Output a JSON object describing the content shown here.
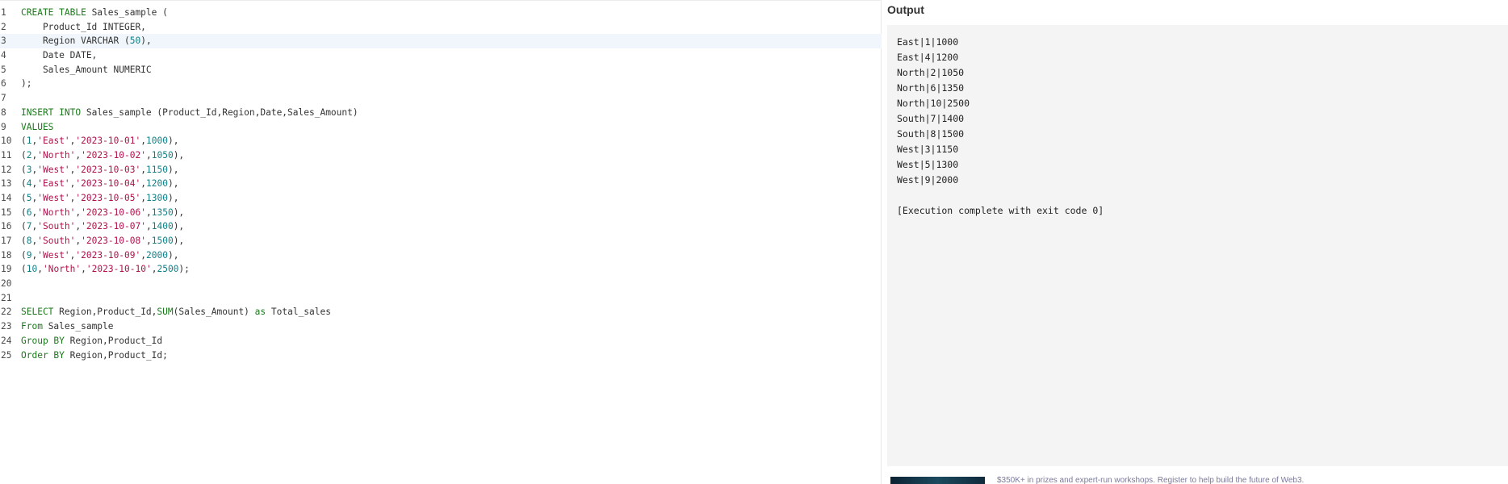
{
  "editor": {
    "active_line": 3,
    "lines": [
      {
        "n": "1",
        "tokens": [
          {
            "t": "CREATE TABLE ",
            "c": "kw"
          },
          {
            "t": "Sales_sample (",
            "c": "plain"
          }
        ]
      },
      {
        "n": "2",
        "tokens": [
          {
            "t": "    Product_Id INTEGER,",
            "c": "plain"
          }
        ]
      },
      {
        "n": "3",
        "tokens": [
          {
            "t": "    Region VARCHAR (",
            "c": "plain"
          },
          {
            "t": "50",
            "c": "num"
          },
          {
            "t": "),",
            "c": "plain"
          }
        ]
      },
      {
        "n": "4",
        "tokens": [
          {
            "t": "    Date DATE,",
            "c": "plain"
          }
        ]
      },
      {
        "n": "5",
        "tokens": [
          {
            "t": "    Sales_Amount NUMERIC",
            "c": "plain"
          }
        ]
      },
      {
        "n": "6",
        "tokens": [
          {
            "t": ");",
            "c": "plain"
          }
        ]
      },
      {
        "n": "7",
        "tokens": []
      },
      {
        "n": "8",
        "tokens": [
          {
            "t": "INSERT INTO ",
            "c": "kw"
          },
          {
            "t": "Sales_sample (Product_Id,Region,Date,Sales_Amount)",
            "c": "plain"
          }
        ]
      },
      {
        "n": "9",
        "tokens": [
          {
            "t": "VALUES",
            "c": "kw"
          }
        ]
      },
      {
        "n": "10",
        "tokens": [
          {
            "t": "(",
            "c": "plain"
          },
          {
            "t": "1",
            "c": "num"
          },
          {
            "t": ",",
            "c": "plain"
          },
          {
            "t": "'East'",
            "c": "str"
          },
          {
            "t": ",",
            "c": "plain"
          },
          {
            "t": "'2023-10-01'",
            "c": "str"
          },
          {
            "t": ",",
            "c": "plain"
          },
          {
            "t": "1000",
            "c": "num"
          },
          {
            "t": "),",
            "c": "plain"
          }
        ]
      },
      {
        "n": "11",
        "tokens": [
          {
            "t": "(",
            "c": "plain"
          },
          {
            "t": "2",
            "c": "num"
          },
          {
            "t": ",",
            "c": "plain"
          },
          {
            "t": "'North'",
            "c": "str"
          },
          {
            "t": ",",
            "c": "plain"
          },
          {
            "t": "'2023-10-02'",
            "c": "str"
          },
          {
            "t": ",",
            "c": "plain"
          },
          {
            "t": "1050",
            "c": "num"
          },
          {
            "t": "),",
            "c": "plain"
          }
        ]
      },
      {
        "n": "12",
        "tokens": [
          {
            "t": "(",
            "c": "plain"
          },
          {
            "t": "3",
            "c": "num"
          },
          {
            "t": ",",
            "c": "plain"
          },
          {
            "t": "'West'",
            "c": "str"
          },
          {
            "t": ",",
            "c": "plain"
          },
          {
            "t": "'2023-10-03'",
            "c": "str"
          },
          {
            "t": ",",
            "c": "plain"
          },
          {
            "t": "1150",
            "c": "num"
          },
          {
            "t": "),",
            "c": "plain"
          }
        ]
      },
      {
        "n": "13",
        "tokens": [
          {
            "t": "(",
            "c": "plain"
          },
          {
            "t": "4",
            "c": "num"
          },
          {
            "t": ",",
            "c": "plain"
          },
          {
            "t": "'East'",
            "c": "str"
          },
          {
            "t": ",",
            "c": "plain"
          },
          {
            "t": "'2023-10-04'",
            "c": "str"
          },
          {
            "t": ",",
            "c": "plain"
          },
          {
            "t": "1200",
            "c": "num"
          },
          {
            "t": "),",
            "c": "plain"
          }
        ]
      },
      {
        "n": "14",
        "tokens": [
          {
            "t": "(",
            "c": "plain"
          },
          {
            "t": "5",
            "c": "num"
          },
          {
            "t": ",",
            "c": "plain"
          },
          {
            "t": "'West'",
            "c": "str"
          },
          {
            "t": ",",
            "c": "plain"
          },
          {
            "t": "'2023-10-05'",
            "c": "str"
          },
          {
            "t": ",",
            "c": "plain"
          },
          {
            "t": "1300",
            "c": "num"
          },
          {
            "t": "),",
            "c": "plain"
          }
        ]
      },
      {
        "n": "15",
        "tokens": [
          {
            "t": "(",
            "c": "plain"
          },
          {
            "t": "6",
            "c": "num"
          },
          {
            "t": ",",
            "c": "plain"
          },
          {
            "t": "'North'",
            "c": "str"
          },
          {
            "t": ",",
            "c": "plain"
          },
          {
            "t": "'2023-10-06'",
            "c": "str"
          },
          {
            "t": ",",
            "c": "plain"
          },
          {
            "t": "1350",
            "c": "num"
          },
          {
            "t": "),",
            "c": "plain"
          }
        ]
      },
      {
        "n": "16",
        "tokens": [
          {
            "t": "(",
            "c": "plain"
          },
          {
            "t": "7",
            "c": "num"
          },
          {
            "t": ",",
            "c": "plain"
          },
          {
            "t": "'South'",
            "c": "str"
          },
          {
            "t": ",",
            "c": "plain"
          },
          {
            "t": "'2023-10-07'",
            "c": "str"
          },
          {
            "t": ",",
            "c": "plain"
          },
          {
            "t": "1400",
            "c": "num"
          },
          {
            "t": "),",
            "c": "plain"
          }
        ]
      },
      {
        "n": "17",
        "tokens": [
          {
            "t": "(",
            "c": "plain"
          },
          {
            "t": "8",
            "c": "num"
          },
          {
            "t": ",",
            "c": "plain"
          },
          {
            "t": "'South'",
            "c": "str"
          },
          {
            "t": ",",
            "c": "plain"
          },
          {
            "t": "'2023-10-08'",
            "c": "str"
          },
          {
            "t": ",",
            "c": "plain"
          },
          {
            "t": "1500",
            "c": "num"
          },
          {
            "t": "),",
            "c": "plain"
          }
        ]
      },
      {
        "n": "18",
        "tokens": [
          {
            "t": "(",
            "c": "plain"
          },
          {
            "t": "9",
            "c": "num"
          },
          {
            "t": ",",
            "c": "plain"
          },
          {
            "t": "'West'",
            "c": "str"
          },
          {
            "t": ",",
            "c": "plain"
          },
          {
            "t": "'2023-10-09'",
            "c": "str"
          },
          {
            "t": ",",
            "c": "plain"
          },
          {
            "t": "2000",
            "c": "num"
          },
          {
            "t": "),",
            "c": "plain"
          }
        ]
      },
      {
        "n": "19",
        "tokens": [
          {
            "t": "(",
            "c": "plain"
          },
          {
            "t": "10",
            "c": "num"
          },
          {
            "t": ",",
            "c": "plain"
          },
          {
            "t": "'North'",
            "c": "str"
          },
          {
            "t": ",",
            "c": "plain"
          },
          {
            "t": "'2023-10-10'",
            "c": "str"
          },
          {
            "t": ",",
            "c": "plain"
          },
          {
            "t": "2500",
            "c": "num"
          },
          {
            "t": ");",
            "c": "plain"
          }
        ]
      },
      {
        "n": "20",
        "tokens": []
      },
      {
        "n": "21",
        "tokens": []
      },
      {
        "n": "22",
        "tokens": [
          {
            "t": "SELECT ",
            "c": "kw"
          },
          {
            "t": "Region,Product_Id,",
            "c": "plain"
          },
          {
            "t": "SUM",
            "c": "kw"
          },
          {
            "t": "(Sales_Amount) ",
            "c": "plain"
          },
          {
            "t": "as ",
            "c": "kw"
          },
          {
            "t": "Total_sales",
            "c": "plain"
          }
        ]
      },
      {
        "n": "23",
        "tokens": [
          {
            "t": "From ",
            "c": "kw"
          },
          {
            "t": "Sales_sample",
            "c": "plain"
          }
        ]
      },
      {
        "n": "24",
        "tokens": [
          {
            "t": "Group BY ",
            "c": "kw"
          },
          {
            "t": "Region,Product_Id",
            "c": "plain"
          }
        ]
      },
      {
        "n": "25",
        "tokens": [
          {
            "t": "Order BY ",
            "c": "kw"
          },
          {
            "t": "Region,Product_Id;",
            "c": "plain"
          }
        ]
      }
    ]
  },
  "output": {
    "title": "Output",
    "lines": [
      "East|1|1000",
      "East|4|1200",
      "North|2|1050",
      "North|6|1350",
      "North|10|2500",
      "South|7|1400",
      "South|8|1500",
      "West|3|1150",
      "West|5|1300",
      "West|9|2000",
      "",
      "[Execution complete with exit code 0]"
    ]
  },
  "ad": {
    "text": "$350K+ in prizes and expert-run workshops. Register to help build the future of Web3."
  }
}
